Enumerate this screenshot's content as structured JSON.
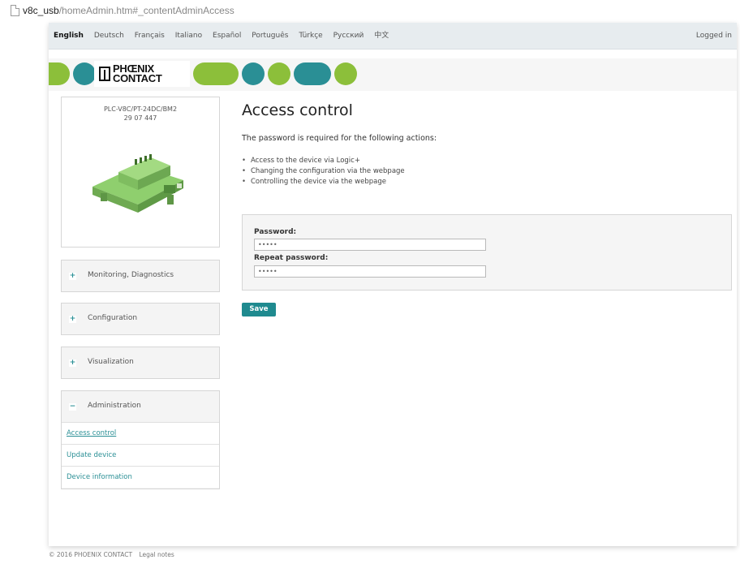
{
  "address_bar": {
    "host": "v8c_usb",
    "path": "/homeAdmin.htm#_contentAdminAccess"
  },
  "languages": [
    {
      "label": "English",
      "active": true
    },
    {
      "label": "Deutsch"
    },
    {
      "label": "Français"
    },
    {
      "label": "Italiano"
    },
    {
      "label": "Español"
    },
    {
      "label": "Português"
    },
    {
      "label": "Türkçe"
    },
    {
      "label": "Русский"
    },
    {
      "label": "中文"
    }
  ],
  "session": {
    "logged_in": "Logged in"
  },
  "brand": {
    "logo_line1": "PHŒNIX",
    "logo_line2": "CONTACT",
    "colors": {
      "green": "#8cbf3a",
      "teal": "#2a8f95"
    }
  },
  "device": {
    "model": "PLC-V8C/PT-24DC/BM2",
    "order_number": "29 07 447",
    "image_icon": "device-module-image"
  },
  "nav": {
    "monitoring": {
      "label": "Monitoring, Diagnostics",
      "toggle": "+"
    },
    "configuration": {
      "label": "Configuration",
      "toggle": "+"
    },
    "visualization": {
      "label": "Visualization",
      "toggle": "+"
    },
    "administration": {
      "label": "Administration",
      "toggle": "−",
      "items": [
        "Access control",
        "Update device",
        "Device information"
      ]
    }
  },
  "main": {
    "title": "Access control",
    "intro": "The password is required for the following actions:",
    "actions": [
      "Access to the device via Logic+",
      "Changing the configuration via the webpage",
      "Controlling the device via the webpage"
    ],
    "form": {
      "password_label": "Password:",
      "password_value": "•••••",
      "repeat_label": "Repeat password:",
      "repeat_value": "•••••"
    },
    "save_label": "Save"
  },
  "footer": {
    "copyright": "© 2016 PHOENIX CONTACT",
    "legal": "Legal notes"
  }
}
